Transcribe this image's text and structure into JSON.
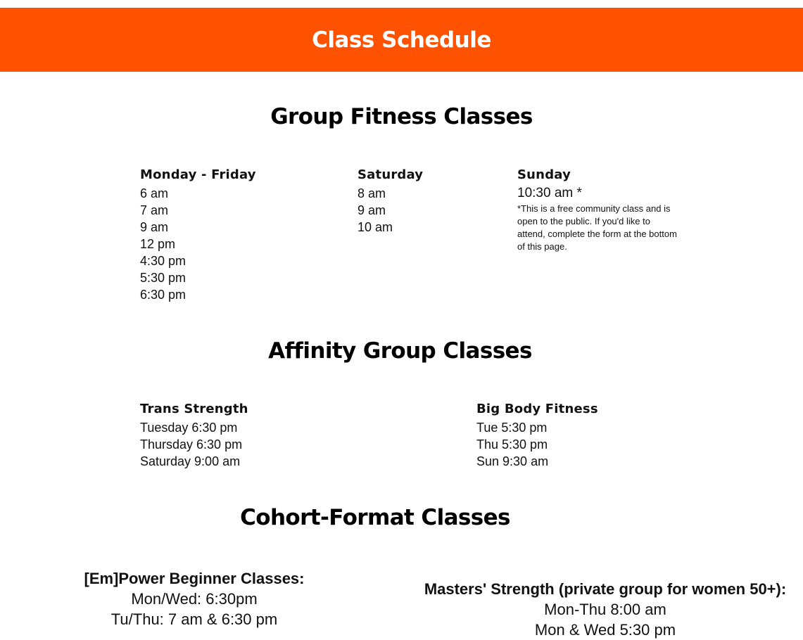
{
  "banner": {
    "title": "Class Schedule",
    "color": "#ff5200"
  },
  "group_fitness": {
    "title": "Group Fitness Classes",
    "columns": [
      {
        "heading": "Monday - Friday",
        "times": [
          "6 am",
          "7 am",
          "9 am",
          "12 pm",
          "4:30 pm",
          "5:30 pm",
          "6:30 pm"
        ]
      },
      {
        "heading": "Saturday",
        "times": [
          "8 am",
          "9 am",
          "10 am"
        ]
      },
      {
        "heading": "Sunday",
        "times": [
          "10:30 am *"
        ],
        "note": "*This is a free community class and is open to the public. If you'd like to attend, complete the form at the bottom of this page."
      }
    ]
  },
  "affinity": {
    "title": "Affinity Group Classes",
    "columns": [
      {
        "heading": "Trans Strength",
        "times": [
          "Tuesday 6:30 pm",
          "Thursday 6:30 pm",
          "Saturday 9:00 am"
        ]
      },
      {
        "heading": "Big Body Fitness",
        "times": [
          "Tue 5:30 pm",
          "Thu 5:30 pm",
          "Sun 9:30 am"
        ]
      }
    ]
  },
  "cohort": {
    "title": "Cohort-Format Classes",
    "columns": [
      {
        "heading": "[Em]Power Beginner Classes:",
        "times": [
          "Mon/Wed: 6:30pm",
          "Tu/Thu: 7 am & 6:30 pm"
        ]
      },
      {
        "heading": "Masters' Strength (private group for women 50+):",
        "times": [
          "Mon-Thu 8:00 am",
          "Mon & Wed 5:30 pm"
        ]
      }
    ]
  }
}
